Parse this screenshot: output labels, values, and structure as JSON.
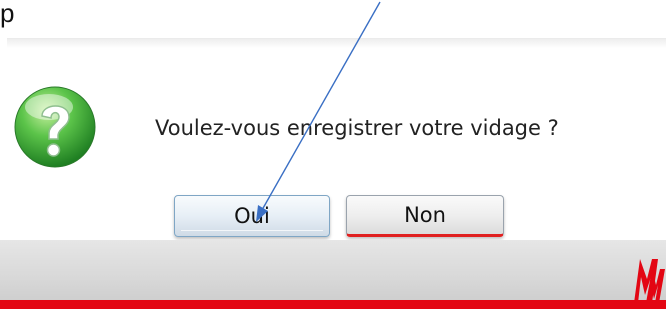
{
  "caption": {
    "text": "p"
  },
  "dialog": {
    "message": "Voulez-vous enregistrer votre vidage ?",
    "icon": "help-question-icon",
    "buttons": {
      "yes_label": "Oui",
      "no_label": "Non"
    }
  },
  "colors": {
    "accent_red": "#e30613",
    "footer_gray": "#d9d9d9",
    "annotation_arrow": "#3a6fc4",
    "icon_green": "#3fae3a"
  },
  "annotation": {
    "type": "arrow-pointer-to-yes-button"
  },
  "branding": {
    "logo": "MW-logo"
  }
}
